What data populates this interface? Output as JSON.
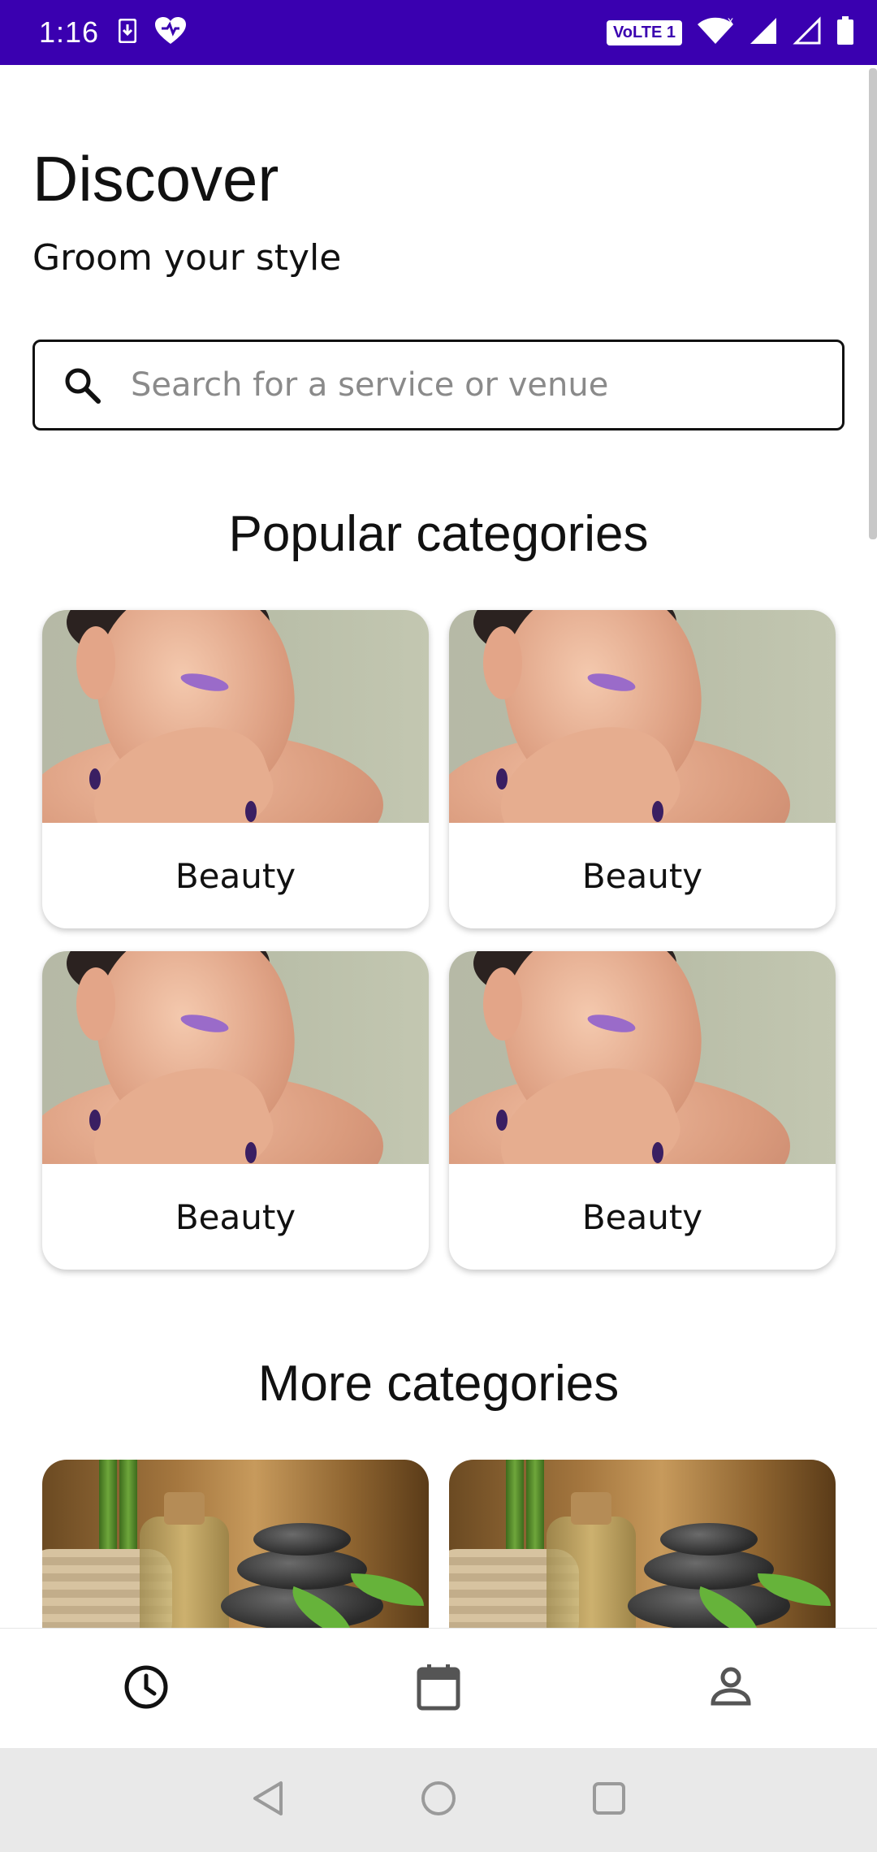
{
  "status_bar": {
    "time": "1:16",
    "network_badge": "VoLTE 1",
    "icons": [
      "download-icon",
      "heart-icon",
      "wifi-icon",
      "signal-icon",
      "signal-empty-icon",
      "battery-icon"
    ],
    "bg_color": "#3a00b0"
  },
  "header": {
    "title": "Discover",
    "subtitle": "Groom your style"
  },
  "search": {
    "placeholder": "Search for a service or venue",
    "icon": "search-icon"
  },
  "popular": {
    "heading": "Popular categories",
    "cards": [
      {
        "label": "Beauty",
        "image": "beauty-photo"
      },
      {
        "label": "Beauty",
        "image": "beauty-photo"
      },
      {
        "label": "Beauty",
        "image": "beauty-photo"
      },
      {
        "label": "Beauty",
        "image": "beauty-photo"
      }
    ]
  },
  "more": {
    "heading": "More categories",
    "cards": [
      {
        "image": "spa-photo"
      },
      {
        "image": "spa-photo"
      }
    ]
  },
  "bottom_nav": {
    "items": [
      {
        "icon": "history-icon",
        "active": true
      },
      {
        "icon": "calendar-icon",
        "active": false
      },
      {
        "icon": "profile-icon",
        "active": false
      }
    ]
  },
  "system_nav": {
    "icons": [
      "back-icon",
      "home-icon",
      "recents-icon"
    ]
  }
}
